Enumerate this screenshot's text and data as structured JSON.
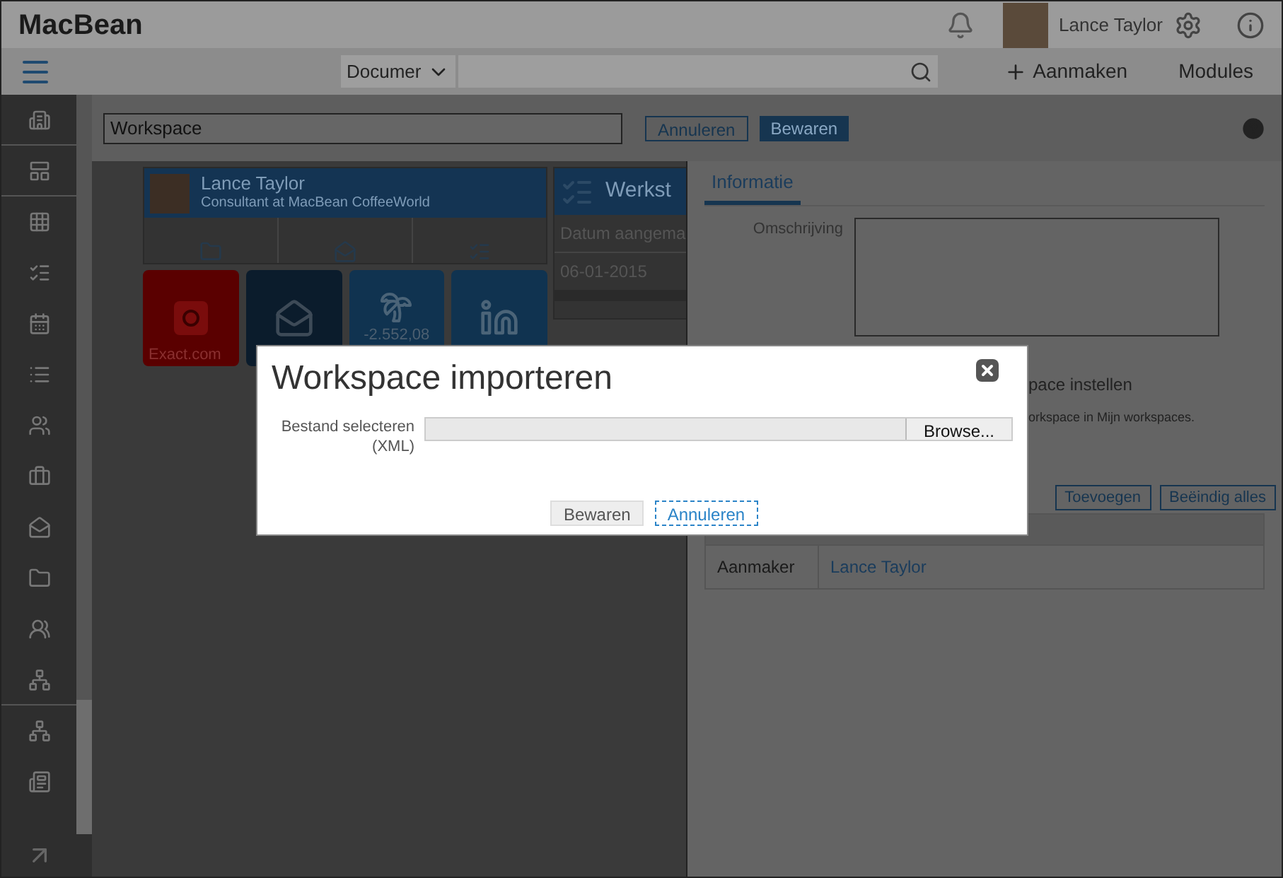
{
  "app": {
    "logo": "MacBean",
    "user_name": "Lance Taylor"
  },
  "toolbar": {
    "search_scope": "Documer",
    "create_label": "Aanmaken",
    "modules_label": "Modules"
  },
  "edit_bar": {
    "name_value": "Workspace",
    "cancel_label": "Annuleren",
    "save_label": "Bewaren"
  },
  "profile_card": {
    "name": "Lance Taylor",
    "subtitle": "Consultant at MacBean CoffeeWorld"
  },
  "tiles": [
    {
      "kind": "exact",
      "label": "Exact.com"
    },
    {
      "kind": "mail"
    },
    {
      "kind": "holiday",
      "label": "-2.552,08"
    },
    {
      "kind": "linkedin"
    }
  ],
  "tasks_card": {
    "title": "Werkst",
    "column": "Datum aangema",
    "date": "06-01-2015"
  },
  "info_panel": {
    "tabs": [
      {
        "label": "Informatie",
        "selected": true
      }
    ],
    "description_label": "Omschrijving",
    "default_option": "pace instellen",
    "hint": "orkspace in Mijn workspaces.",
    "buttons": [
      "Toevoegen",
      "Beëindig alles"
    ],
    "rows": [
      {
        "label": "Aanmaker",
        "value": "Lance Taylor"
      }
    ]
  },
  "dialog": {
    "title": "Workspace importeren",
    "file_label": "Bestand selecteren (XML)",
    "browse_label": "Browse...",
    "save_label": "Bewaren",
    "cancel_label": "Annuleren"
  }
}
